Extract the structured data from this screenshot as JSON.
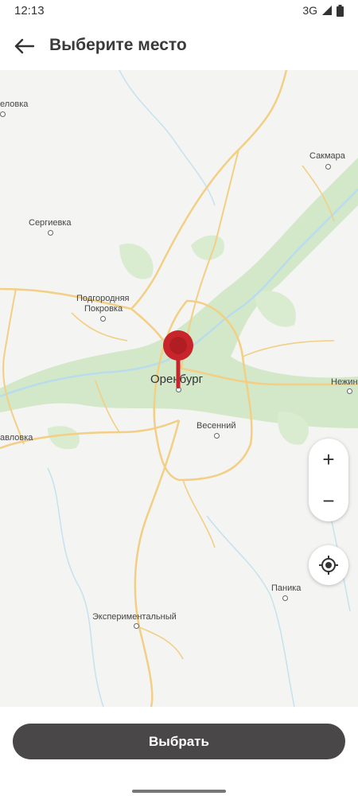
{
  "status_bar": {
    "time": "12:13",
    "network": "3G"
  },
  "app_bar": {
    "title": "Выберите место"
  },
  "map": {
    "city": "Оренбург",
    "places": {
      "lovka_top": "еловка",
      "sakmara": "Сакмара",
      "sergievka": "Сергиевка",
      "podgorodnyaya_1": "Подгородняя",
      "podgorodnyaya_2": "Покровка",
      "nezhinka": "Нежинк",
      "pavlovka": "авловка",
      "vesenny": "Весенний",
      "panika": "Паника",
      "experimentalny": "Экспериментальный"
    },
    "colors": {
      "road": "#f5d38a",
      "forest": "#cfe6c3",
      "water": "#cde6f2",
      "land": "#f4f4f2",
      "pin": "#c8242b"
    }
  },
  "controls": {
    "zoom_in": "+",
    "zoom_out": "−"
  },
  "bottom": {
    "select_label": "Выбрать"
  }
}
